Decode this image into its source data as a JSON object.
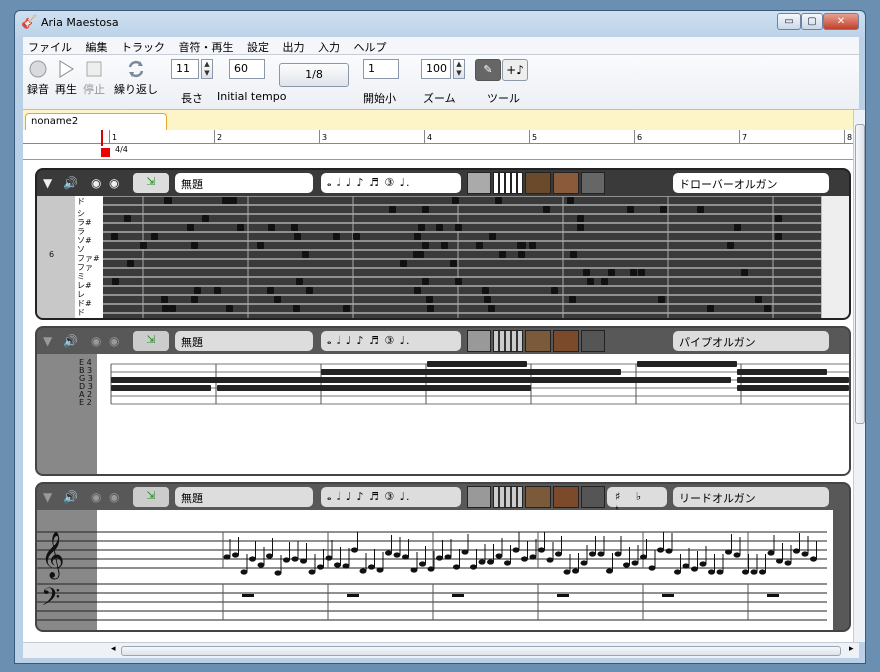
{
  "window": {
    "title": "Aria Maestosa",
    "controls": [
      "▭",
      "▢",
      "✕"
    ]
  },
  "menu": [
    "ファイル",
    "編集",
    "トラック",
    "音符・再生",
    "設定",
    "出力",
    "入力",
    "ヘルプ"
  ],
  "toolbar": {
    "record_label": "録音",
    "play_label": "再生",
    "stop_label": "停止",
    "loop_label": "繰り返し",
    "length_value": "11",
    "length_label": "長さ",
    "tempo_value": "60",
    "tempo_label": "Initial tempo",
    "timesig_value": "1/8",
    "start_value": "1",
    "start_label": "開始小",
    "zoom_value": "100",
    "zoom_label": "ズーム",
    "tool_label": "ツール"
  },
  "tab": {
    "name": "noname2"
  },
  "ruler": {
    "measures": [
      "1",
      "2",
      "3",
      "4",
      "5",
      "6",
      "7",
      "8"
    ],
    "time_signature": "4/4"
  },
  "tracks": [
    {
      "name": "無題",
      "notes_glyphs": "𝅝 𝅗𝅥 ♩ ♪ ♬ ③ ♩.",
      "instrument": "ドローバーオルガン",
      "keyboard_labels": [
        "ド",
        "シ",
        "ラ#",
        "ラ",
        "ソ#",
        "ソ",
        "ファ#",
        "ファ",
        "ミ",
        "レ#",
        "レ",
        "ド#",
        "ド"
      ],
      "octave_label": "6"
    },
    {
      "name": "無題",
      "notes_glyphs": "𝅝 𝅗𝅥 ♩ ♪ ♬ ③ ♩.",
      "instrument": "パイプオルガン",
      "string_labels": [
        "E 4",
        "B 3",
        "G 3",
        "D 3",
        "A 2",
        "E 2"
      ]
    },
    {
      "name": "無題",
      "notes_glyphs": "𝅝 𝅗𝅥 ♩ ♪ ♬ ③ ♩.",
      "accidentals": "♯ ♭ ♮",
      "instrument": "リードオルガン"
    }
  ],
  "colors": {
    "track_active": "#3a3a3a",
    "track_inactive": "#585858",
    "tab_bg": "#fdf4c8",
    "playhead": "#dd0000"
  }
}
